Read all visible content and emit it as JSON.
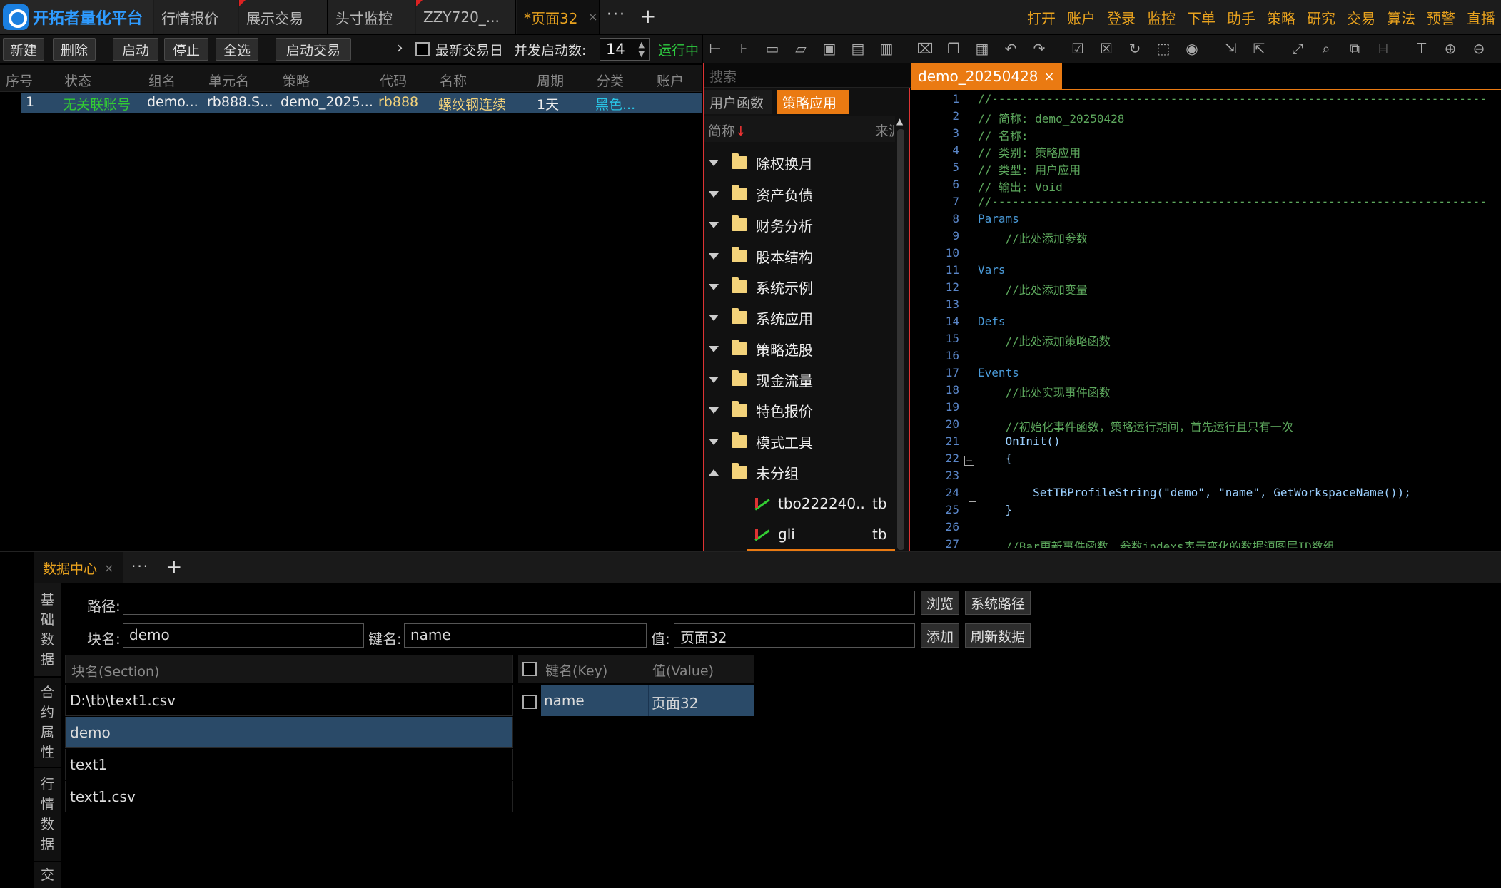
{
  "app": {
    "title": "开拓者量化平台"
  },
  "top_tabs": [
    {
      "label": "行情报价",
      "marked": false,
      "active": false
    },
    {
      "label": "展示交易",
      "marked": true,
      "active": false
    },
    {
      "label": "头寸监控",
      "marked": false,
      "active": false
    },
    {
      "label": "ZZY720_...",
      "marked": true,
      "active": false
    },
    {
      "label": "*页面32",
      "marked": false,
      "active": true,
      "close": "×"
    }
  ],
  "tab_more": "···",
  "tab_add": "+",
  "top_menu": [
    "打开",
    "账户",
    "登录",
    "监控",
    "下单",
    "助手",
    "策略",
    "研究",
    "交易",
    "算法",
    "预警",
    "直播"
  ],
  "toolbar": {
    "new": "新建",
    "delete": "删除",
    "start": "启动",
    "stop": "停止",
    "select_all": "全选",
    "start_trade": "启动交易",
    "chevron": "›",
    "latest_day_label": "最新交易日",
    "concurrency_label": "并发启动数:",
    "concurrency_value": "14",
    "running": "运行中"
  },
  "units_table": {
    "headers": [
      "序号",
      "状态",
      "组名",
      "单元名",
      "策略",
      "代码",
      "名称",
      "周期",
      "分类",
      "账户"
    ],
    "rows": [
      {
        "index": "1",
        "status": "无关联账号",
        "group": "demo...",
        "unit": "rb888.S...",
        "strategy": "demo_2025...",
        "code": "rb888",
        "name": "螺纹钢连续",
        "period": "1天",
        "category": "黑色..."
      }
    ]
  },
  "func_panel": {
    "search_placeholder": "搜索",
    "tabs": [
      "用户函数",
      "策略应用"
    ],
    "header_name": "简称",
    "header_sort": "↓",
    "header_source": "来源",
    "folders": [
      {
        "label": "除权换月",
        "expanded": false
      },
      {
        "label": "资产负债",
        "expanded": false
      },
      {
        "label": "财务分析",
        "expanded": false
      },
      {
        "label": "股本结构",
        "expanded": false
      },
      {
        "label": "系统示例",
        "expanded": false
      },
      {
        "label": "系统应用",
        "expanded": false
      },
      {
        "label": "策略选股",
        "expanded": false
      },
      {
        "label": "现金流量",
        "expanded": false
      },
      {
        "label": "特色报价",
        "expanded": false
      },
      {
        "label": "模式工具",
        "expanded": false
      },
      {
        "label": "未分组",
        "expanded": true
      }
    ],
    "leaves": [
      {
        "label": "tbo222240...",
        "source": "tb"
      },
      {
        "label": "gli",
        "source": "tb"
      }
    ]
  },
  "editor": {
    "tab_label": "demo_20250428",
    "tab_close": "×",
    "lines": [
      {
        "n": "1",
        "text": "//------------------------------------------------------------------------",
        "cls": "c-com"
      },
      {
        "n": "2",
        "text": "// 简称: demo_20250428",
        "cls": "c-com"
      },
      {
        "n": "3",
        "text": "// 名称:",
        "cls": "c-com"
      },
      {
        "n": "4",
        "text": "// 类别: 策略应用",
        "cls": "c-com"
      },
      {
        "n": "5",
        "text": "// 类型: 用户应用",
        "cls": "c-com"
      },
      {
        "n": "6",
        "text": "// 输出: Void",
        "cls": "c-com"
      },
      {
        "n": "7",
        "text": "//------------------------------------------------------------------------",
        "cls": "c-com"
      },
      {
        "n": "8",
        "text": "Params",
        "cls": "c-kw"
      },
      {
        "n": "9",
        "text": "    //此处添加参数",
        "cls": "c-com"
      },
      {
        "n": "10",
        "text": "",
        "cls": "c-com"
      },
      {
        "n": "11",
        "text": "Vars",
        "cls": "c-kw"
      },
      {
        "n": "12",
        "text": "    //此处添加变量",
        "cls": "c-com"
      },
      {
        "n": "13",
        "text": "",
        "cls": "c-com"
      },
      {
        "n": "14",
        "text": "Defs",
        "cls": "c-kw"
      },
      {
        "n": "15",
        "text": "    //此处添加策略函数",
        "cls": "c-com"
      },
      {
        "n": "16",
        "text": "",
        "cls": "c-com"
      },
      {
        "n": "17",
        "text": "Events",
        "cls": "c-kw"
      },
      {
        "n": "18",
        "text": "    //此处实现事件函数",
        "cls": "c-com"
      },
      {
        "n": "19",
        "text": "",
        "cls": "c-com"
      },
      {
        "n": "20",
        "text": "    //初始化事件函数，策略运行期间，首先运行且只有一次",
        "cls": "c-com"
      },
      {
        "n": "21",
        "text": "    OnInit()",
        "cls": "c-fn"
      },
      {
        "n": "22",
        "text": "    {",
        "cls": "c-fn"
      },
      {
        "n": "23",
        "text": "",
        "cls": "c-com"
      },
      {
        "n": "24",
        "text": "        SetTBProfileString(\"demo\", \"name\", GetWorkspaceName());",
        "cls": "c-fn"
      },
      {
        "n": "25",
        "text": "    }",
        "cls": "c-fn"
      },
      {
        "n": "26",
        "text": "",
        "cls": "c-com"
      },
      {
        "n": "27",
        "text": "    //Bar更新事件函数，参数indexs表示变化的数据源图层ID数组",
        "cls": "c-com"
      }
    ]
  },
  "data_center": {
    "tab_label": "数据中心",
    "tab_close": "×",
    "more": "···",
    "add": "+",
    "side_nav": [
      "基础数据",
      "合约属性",
      "行情数据",
      "交"
    ],
    "path_label": "路径:",
    "path_value": "",
    "browse": "浏览",
    "system_path": "系统路径",
    "block_label": "块名:",
    "block_value": "demo",
    "key_label": "键名:",
    "key_value": "name",
    "value_label": "值:",
    "value_value": "页面32",
    "add_btn": "添加",
    "refresh_btn": "刷新数据",
    "section_header": "块名(Section)",
    "sections": [
      {
        "label": "D:\\tb\\text1.csv",
        "selected": false
      },
      {
        "label": "demo",
        "selected": true
      },
      {
        "label": "text1",
        "selected": false
      },
      {
        "label": "text1.csv",
        "selected": false
      }
    ],
    "kv_header_key": "键名(Key)",
    "kv_header_value": "值(Value)",
    "kv_rows": [
      {
        "key": "name",
        "value": "页面32"
      }
    ]
  }
}
